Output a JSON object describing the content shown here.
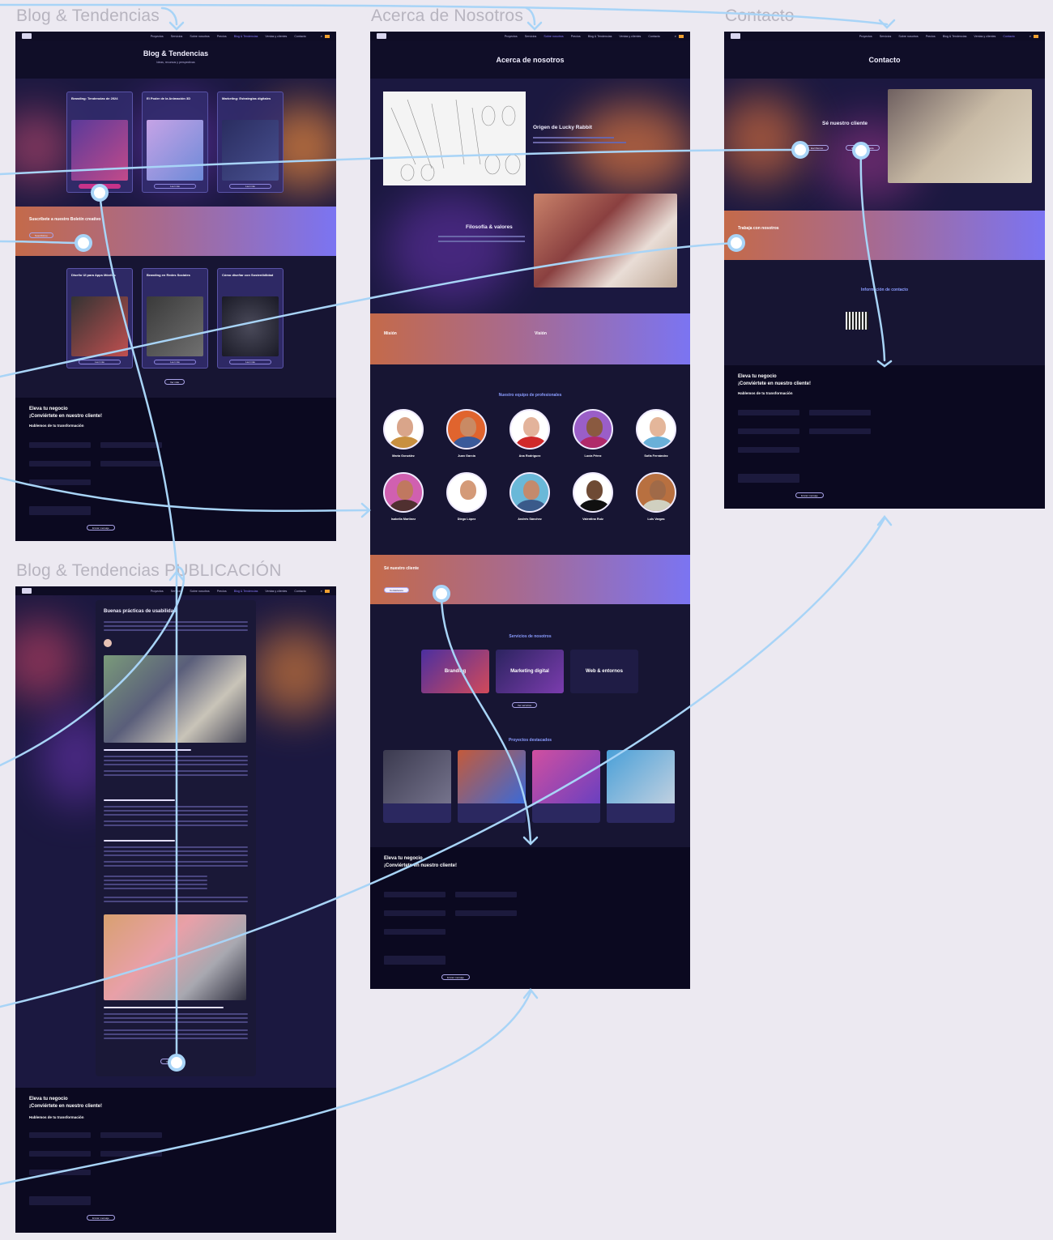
{
  "frames": {
    "blog": {
      "label": "Blog & Tendencias"
    },
    "about": {
      "label": "Acerca de Nosotros"
    },
    "contact": {
      "label": "Contacto"
    },
    "post": {
      "label": "Blog & Tendencias PUBLICACIÓN"
    }
  },
  "nav": {
    "links": [
      "Proyectos",
      "Servicios",
      "Sobre nosotros",
      "Precios",
      "Blog & Tendencias",
      "Ventas y clientes",
      "Contacto"
    ]
  },
  "blog_page": {
    "title": "Blog & Tendencias",
    "subtitle": "Ideas, recursos y perspectivas",
    "cards_top": [
      {
        "title": "Branding: Tendencias de 2024"
      },
      {
        "title": "El Poder de la Animación 3D"
      },
      {
        "title": "Marketing: Estrategias digitales"
      }
    ],
    "newsletter_title": "Suscríbete a nuestro Boletín creativo",
    "cards_bottom": [
      {
        "title": "Diseño UI para Apps Móviles"
      },
      {
        "title": "Branding en Redes Sociales"
      },
      {
        "title": "Cómo diseñar con Sostenibilidad"
      }
    ],
    "more_button": "Ver más",
    "footer_title": "Eleva tu negocio",
    "footer_title2": "¡Conviértete en nuestro cliente!",
    "footer_subtitle": "Hablemos de tu transformación",
    "send_button": "Enviar mensaje"
  },
  "about_page": {
    "title": "Acerca de nosotros",
    "origin_title": "Origen de Lucky Rabbit",
    "philosophy_title": "Filosofía & valores",
    "mission_title": "Misión",
    "vision_title": "Visión",
    "team_title": "Nuestro equipo de profesionales",
    "team": [
      {
        "name": "María González"
      },
      {
        "name": "Juan García"
      },
      {
        "name": "Ana Rodríguez"
      },
      {
        "name": "Lucía Pérez"
      },
      {
        "name": "Sofía Fernández"
      },
      {
        "name": "Isabella Martínez"
      },
      {
        "name": "Diego López"
      },
      {
        "name": "Andrés Sánchez"
      },
      {
        "name": "Valentina Ruiz"
      },
      {
        "name": "Luis Vargas"
      }
    ],
    "client_band_title": "Sé nuestro cliente",
    "services_title": "Servicios de nosotros",
    "services": [
      "Branding",
      "Marketing digital",
      "Web & entornos"
    ],
    "projects_title": "Proyectos destacados",
    "footer_title": "Eleva tu negocio",
    "footer_title2": "¡Conviértete en nuestro cliente!",
    "send_button": "Enviar mensaje"
  },
  "contact_page": {
    "title": "Contacto",
    "client_title": "Sé nuestro cliente",
    "work_title": "Trabaja con nosotros",
    "info_title": "Información de contacto",
    "footer_title": "Eleva tu negocio",
    "footer_title2": "¡Conviértete en nuestro cliente!",
    "footer_subtitle": "Hablemos de tu transformación",
    "send_button": "Enviar mensaje"
  },
  "post_page": {
    "title": "Buenas prácticas de usabilidad",
    "footer_title": "Eleva tu negocio",
    "footer_title2": "¡Conviértete en nuestro cliente!",
    "footer_subtitle": "Hablemos de tu transformación",
    "send_button": "Enviar mensaje"
  },
  "colors": {
    "page_bg": "#171533",
    "accent": "#7b74f2",
    "warm": "#c46a4a",
    "link_arrow": "#a8d4f7"
  }
}
